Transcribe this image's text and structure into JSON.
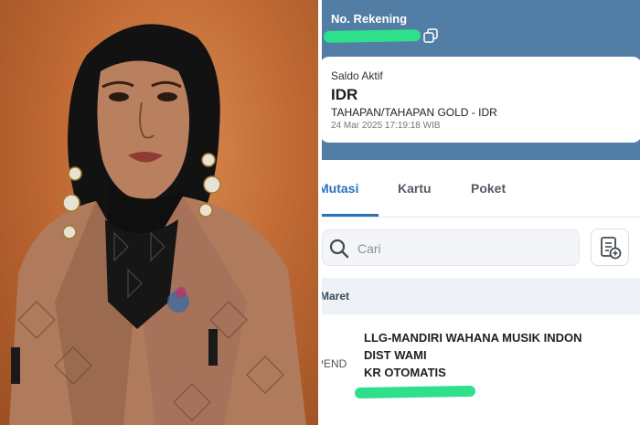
{
  "account": {
    "label": "No. Rekening",
    "saldo_label": "Saldo Aktif",
    "currency": "IDR",
    "product": "TAHAPAN/TAHAPAN GOLD - IDR",
    "timestamp": "24 Mar 2025 17:19:18 WIB"
  },
  "tabs": [
    {
      "label": "Mutasi",
      "active": true
    },
    {
      "label": "Kartu",
      "active": false
    },
    {
      "label": "Poket",
      "active": false
    }
  ],
  "search": {
    "placeholder": "Cari"
  },
  "month": "Maret",
  "transaction": {
    "type": "PEND",
    "lines": [
      "LLG-MANDIRI WAHANA MUSIK INDON",
      "DIST WAMI",
      "KR OTOMATIS"
    ]
  },
  "colors": {
    "header_blue": "#527ea6",
    "accent_blue": "#2a73b8",
    "redaction_green": "#2fe08b",
    "photo_bg": "#c26b35"
  },
  "icons": [
    "copy-icon",
    "search-icon",
    "document-icon"
  ]
}
